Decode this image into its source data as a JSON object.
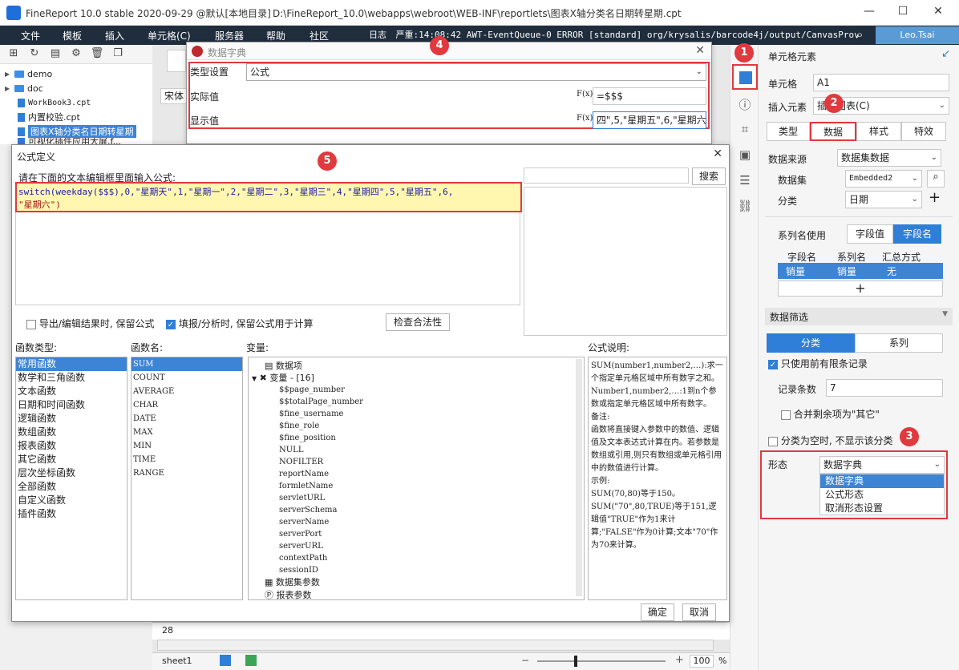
{
  "app": {
    "title": "FineReport 10.0 stable 2020-09-29 @默认[本地目录]",
    "path": "D:\\FineReport_10.0\\webapps\\webroot\\WEB-INF\\reportlets\\图表X轴分类名日期转星期.cpt",
    "window_minimize": "—",
    "window_maximize": "☐",
    "window_close": "✕"
  },
  "menubar": {
    "items": [
      "文件",
      "模板",
      "插入",
      "单元格(C)",
      "服务器",
      "帮助",
      "社区"
    ],
    "log_label": "日志",
    "log_text": "严重:14:08:42 AWT-EventQueue-0 ERROR [standard] org/krysalis/barcode4j/output/CanvasProvider",
    "user": "Leo.Tsai"
  },
  "filetree": {
    "items": [
      {
        "label": "demo",
        "type": "folder"
      },
      {
        "label": "doc",
        "type": "folder"
      },
      {
        "label": "WorkBook3.cpt",
        "type": "file"
      },
      {
        "label": "内置校验.cpt",
        "type": "file"
      },
      {
        "label": "图表X轴分类名日期转星期",
        "type": "file",
        "selected": true
      },
      {
        "label": "可视化插件应用大屏.f...",
        "type": "file"
      }
    ]
  },
  "editor": {
    "font_name": "宋体",
    "row_number": "28",
    "sheet_tab": "sheet1",
    "zoom": "100",
    "zoom_unit": "%",
    "zoom_minus": "−",
    "zoom_plus": "+"
  },
  "dict_dialog": {
    "title": "数据字典",
    "type_label": "类型设置",
    "type_value": "公式",
    "actual_label": "实际值",
    "actual_value": "=$$$",
    "display_label": "显示值",
    "display_value": "四\",5,\"星期五\",6,\"星期六\")",
    "fx_label": "F(x)"
  },
  "formula_dialog": {
    "title": "公式定义",
    "prompt": "请在下面的文本编辑框里面输入公式:",
    "formula_line1": "switch(weekday($$$),0,\"星期天\",1,\"星期一\",2,\"星期二\",3,\"星期三\",4,\"星期四\",5,\"星期五\",6,",
    "formula_line2": "\"星期六\")",
    "search_button": "搜索",
    "check_export": "导出/编辑结果时, 保留公式",
    "check_fill": "填报/分析时, 保留公式用于计算",
    "check_validity": "检查合法性",
    "func_type_label": "函数类型:",
    "func_name_label": "函数名:",
    "variable_label": "变量:",
    "desc_label": "公式说明:",
    "func_types": [
      "常用函数",
      "数学和三角函数",
      "文本函数",
      "日期和时间函数",
      "逻辑函数",
      "数组函数",
      "报表函数",
      "其它函数",
      "层次坐标函数",
      "全部函数",
      "自定义函数",
      "插件函数"
    ],
    "func_names": [
      "SUM",
      "COUNT",
      "AVERAGE",
      "CHAR",
      "DATE",
      "MAX",
      "MIN",
      "TIME",
      "RANGE"
    ],
    "var_root_data": "数据项",
    "var_root_vars": "变量 - [16]",
    "variables": [
      "$$page_number",
      "$$totalPage_number",
      "$fine_username",
      "$fine_role",
      "$fine_position",
      "NULL",
      "NOFILTER",
      "reportName",
      "formletName",
      "servletURL",
      "serverSchema",
      "serverName",
      "serverPort",
      "serverURL",
      "contextPath",
      "sessionID"
    ],
    "var_dataset_params": "数据集参数",
    "var_report_params": "报表参数",
    "description": "SUM(number1,number2,…):求一个指定单元格区域中所有数字之和。\nNumber1,number2,…:1到n个参数或指定单元格区域中所有数字。\n备注:\n函数将直接键入参数中的数值、逻辑值及文本表达式计算在内。若参数是数组或引用,则只有数组或单元格引用中的数值进行计算。\n示例:\nSUM(70,80)等于150。\nSUM(\"70\",80,TRUE)等于151,逻辑值\"TRUE\"作为1来计算;\"FALSE\"作为0计算;文本\"70\"作为70来计算。",
    "ok_button": "确定",
    "cancel_button": "取消"
  },
  "right_panel": {
    "title": "单元格元素",
    "cell_label": "单元格",
    "cell_value": "A1",
    "insert_label": "插入元素",
    "insert_value": "插入图表(C)",
    "tabs": [
      "类型",
      "数据",
      "样式",
      "特效"
    ],
    "datasource_label": "数据来源",
    "datasource_value": "数据集数据",
    "dataset_label": "数据集",
    "dataset_value": "Embedded2",
    "category_label": "分类",
    "category_value": "日期",
    "series_use_label": "系列名使用",
    "series_use_options": [
      "字段值",
      "字段名"
    ],
    "table_headers": [
      "字段名",
      "系列名",
      "汇总方式"
    ],
    "table_row": [
      "销量",
      "销量",
      "无"
    ],
    "add_symbol": "+",
    "filter_label": "数据筛选",
    "filter_tabs": [
      "分类",
      "系列"
    ],
    "top_records_label": "只使用前有限条记录",
    "record_count_label": "记录条数",
    "record_count_value": "7",
    "merge_label": "合并剩余项为\"其它\"",
    "hide_empty_label": "分类为空时, 不显示该分类",
    "form_label": "形态",
    "form_value": "数据字典",
    "form_options": [
      "数据字典",
      "公式形态",
      "取消形态设置"
    ]
  },
  "badges": [
    "1",
    "2",
    "3",
    "4",
    "5"
  ],
  "colors": {
    "accent": "#2f7ed8",
    "menubar": "#1f2d3d",
    "annotation": "#e0393e",
    "formula_bg": "#fff7b0",
    "keyword": "#1a1aa6",
    "string": "#a31515"
  }
}
